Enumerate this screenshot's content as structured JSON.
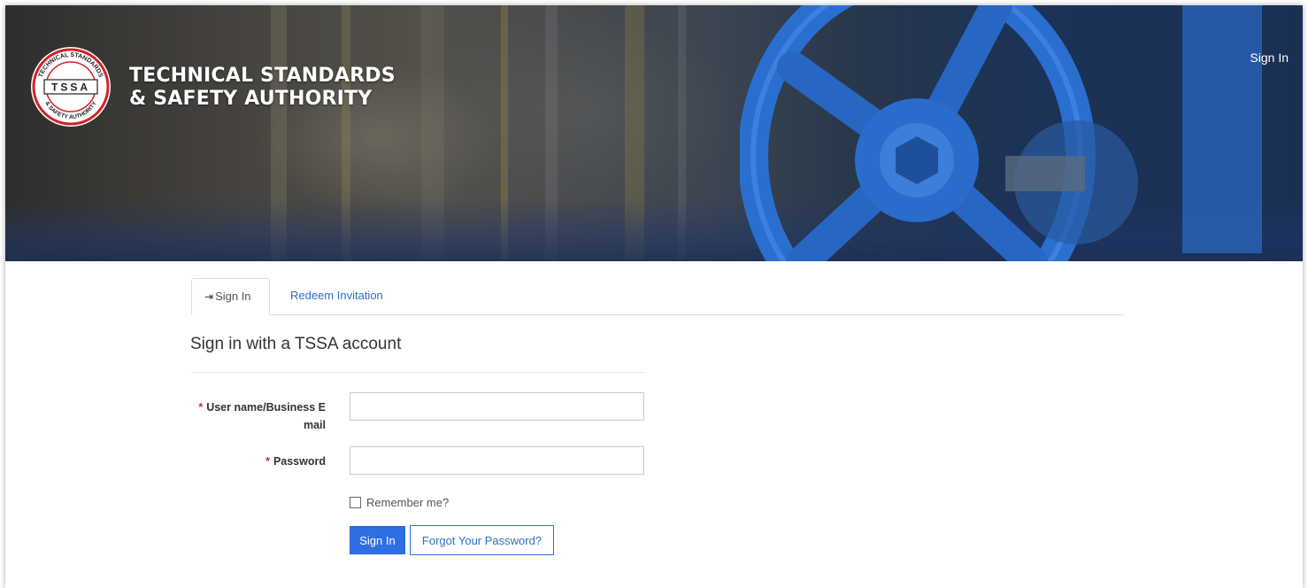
{
  "brand": {
    "line1": "TECHNICAL STANDARDS",
    "line2": "& SAFETY AUTHORITY",
    "logo_text": "TSSA",
    "logo_ring_top": "TECHNICAL STANDARDS",
    "logo_ring_bottom": "& SAFETY AUTHORITY"
  },
  "header": {
    "signin_link": "Sign In"
  },
  "tabs": [
    {
      "label": "Sign In",
      "active": true,
      "icon": "sign-in-icon"
    },
    {
      "label": "Redeem Invitation",
      "active": false
    }
  ],
  "form": {
    "heading": "Sign in with a TSSA account",
    "required_marker": "*",
    "username_label_line1": "User name/Business E",
    "username_label_line2": "mail",
    "username_value": "",
    "password_label": "Password",
    "password_value": "",
    "remember_label": "Remember me?",
    "remember_checked": false,
    "submit_label": "Sign In",
    "forgot_label": "Forgot Your Password?"
  },
  "colors": {
    "primary": "#2f6fe4",
    "link": "#2f6fc3",
    "required": "#c9302c",
    "logo_red": "#d2232a"
  }
}
